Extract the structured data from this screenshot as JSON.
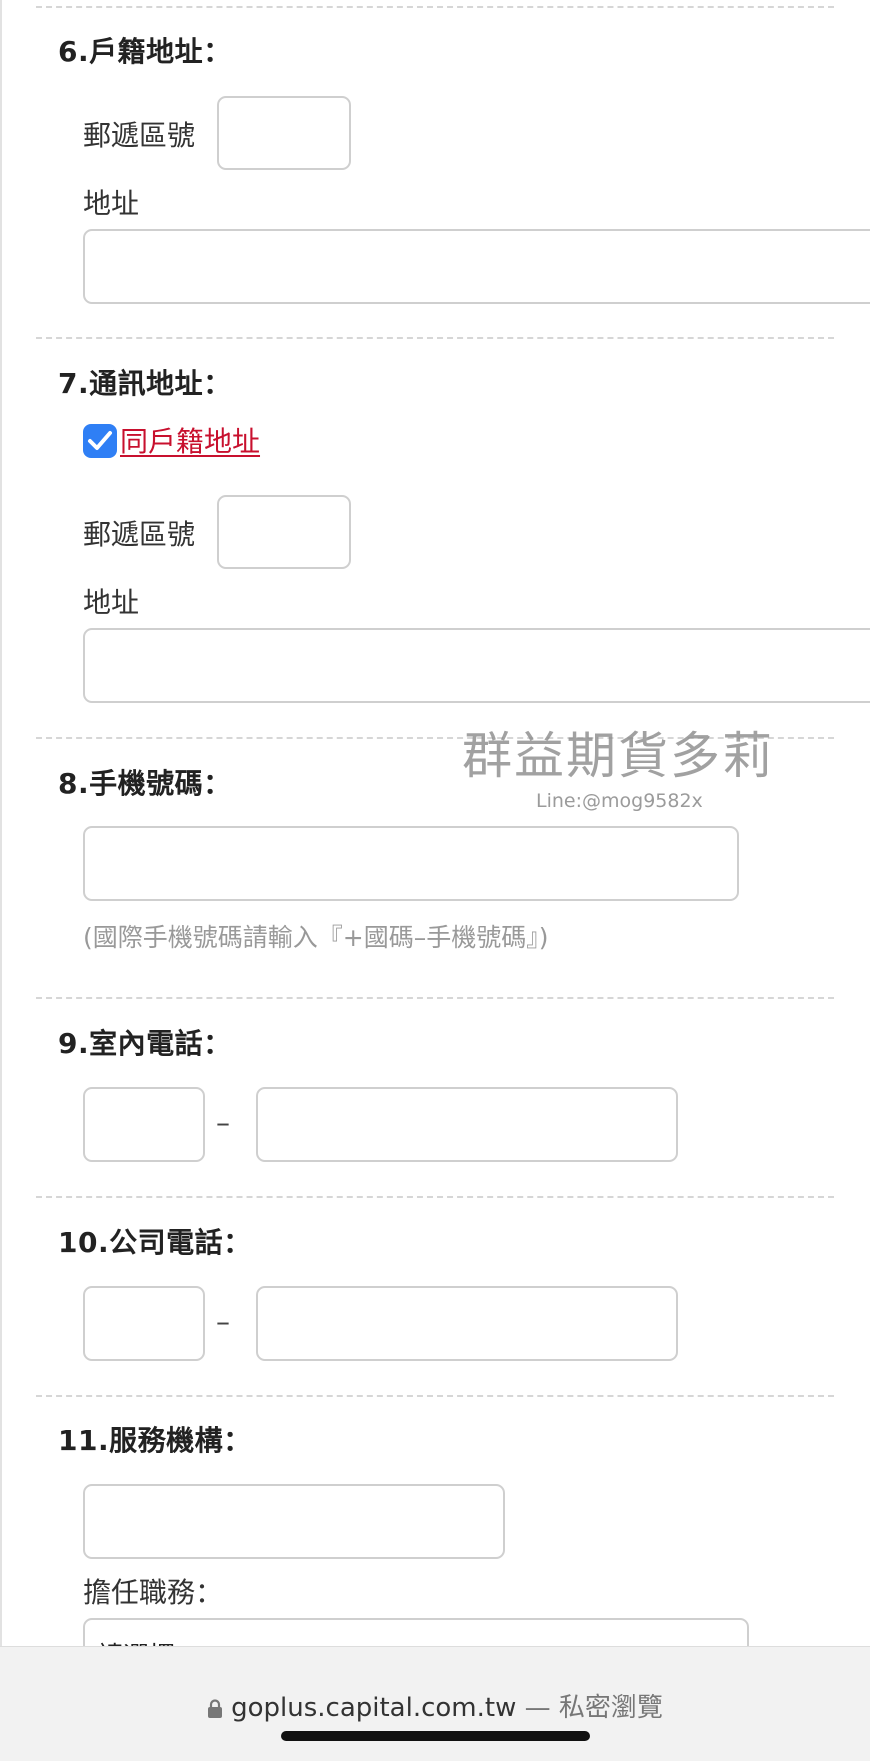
{
  "form": {
    "s6": {
      "heading": "6.戶籍地址：",
      "postal_label": "郵遞區號",
      "postal_value": "",
      "address_label": "地址",
      "address_value": ""
    },
    "s7": {
      "heading": "7.通訊地址：",
      "same_as_label": "同戶籍地址",
      "same_as_checked": true,
      "postal_label": "郵遞區號",
      "postal_value": "",
      "address_label": "地址",
      "address_value": ""
    },
    "s8": {
      "heading": "8.手機號碼：",
      "mobile_value": "",
      "hint": "(國際手機號碼請輸入『+國碼–手機號碼』)"
    },
    "s9": {
      "heading": "9.室內電話：",
      "area_value": "",
      "separator": "–",
      "number_value": ""
    },
    "s10": {
      "heading": "10.公司電話：",
      "area_value": "",
      "separator": "–",
      "number_value": ""
    },
    "s11": {
      "heading": "11.服務機構：",
      "org_value": "",
      "position_label": "擔任職務：",
      "position_selected": "請選擇"
    }
  },
  "watermark": {
    "title": "群益期貨多莉",
    "line": "Line:@mog9582x"
  },
  "browser": {
    "url": "goplus.capital.com.tw",
    "mode": "— 私密瀏覽",
    "lock_icon": "lock-icon"
  },
  "colors": {
    "checkbox": "#2f7ff5",
    "link": "#c8102e",
    "input_border": "#cfcfcf",
    "hint": "#999999"
  }
}
